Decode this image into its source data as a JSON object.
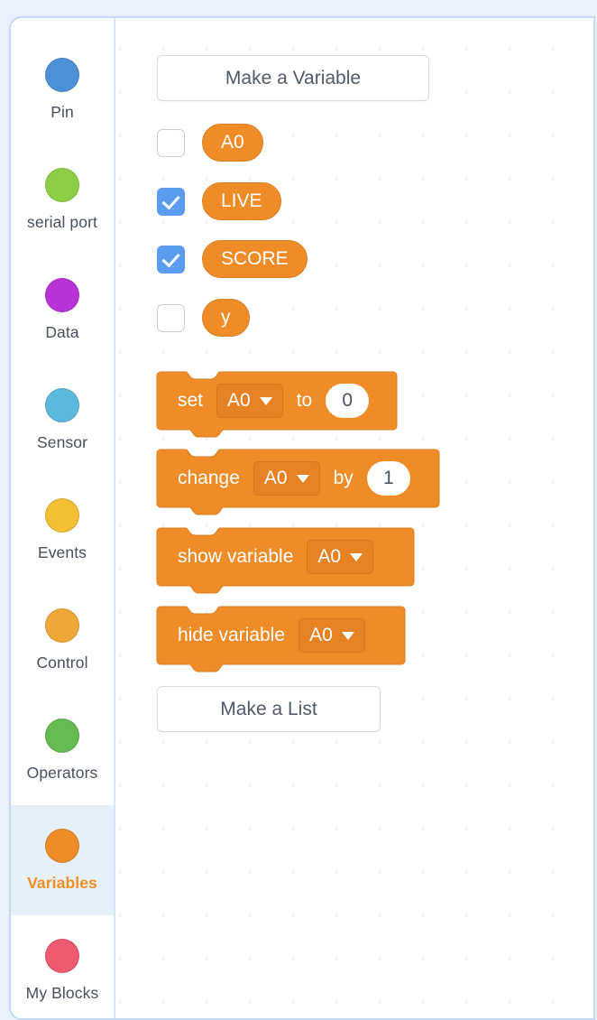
{
  "theme": {
    "block_orange": "#ef8c28",
    "block_orange_dark": "#d97e22",
    "checkbox_blue": "#5a9cf0",
    "selected_category_bg": "#e5f0fb",
    "selected_category_text": "#f2901f",
    "label_text": "#47505f",
    "frame_border": "#c5daf0",
    "page_bg": "#e8f1fb"
  },
  "sidebar": {
    "items": [
      {
        "label": "Pin",
        "color": "#4c91d8",
        "icon": "category-dot-icon",
        "selected": false
      },
      {
        "label": "serial port",
        "color": "#8ccf46",
        "icon": "category-dot-icon",
        "selected": false
      },
      {
        "label": "Data",
        "color": "#b932d6",
        "icon": "category-dot-icon",
        "selected": false
      },
      {
        "label": "Sensor",
        "color": "#5cb8dc",
        "icon": "category-dot-icon",
        "selected": false
      },
      {
        "label": "Events",
        "color": "#f3bf35",
        "icon": "category-dot-icon",
        "selected": false
      },
      {
        "label": "Control",
        "color": "#f0a73a",
        "icon": "category-dot-icon",
        "selected": false
      },
      {
        "label": "Operators",
        "color": "#63bb52",
        "icon": "category-dot-icon",
        "selected": false
      },
      {
        "label": "Variables",
        "color": "#ef8c28",
        "icon": "category-dot-icon",
        "selected": true
      },
      {
        "label": "My Blocks",
        "color": "#ef5a70",
        "icon": "category-dot-icon",
        "selected": false
      }
    ]
  },
  "palette": {
    "make_variable_label": "Make a Variable",
    "make_list_label": "Make a List",
    "variables": [
      {
        "name": "A0",
        "checked": false
      },
      {
        "name": "LIVE",
        "checked": true
      },
      {
        "name": "SCORE",
        "checked": true
      },
      {
        "name": "y",
        "checked": false
      }
    ],
    "blocks": [
      {
        "id": "set-variable-block",
        "word1": "set",
        "dropdown": "A0",
        "word2": "to",
        "value": "0"
      },
      {
        "id": "change-variable-block",
        "word1": "change",
        "dropdown": "A0",
        "word2": "by",
        "value": "1"
      },
      {
        "id": "show-variable-block",
        "word1": "show variable",
        "dropdown": "A0"
      },
      {
        "id": "hide-variable-block",
        "word1": "hide variable",
        "dropdown": "A0"
      }
    ]
  }
}
